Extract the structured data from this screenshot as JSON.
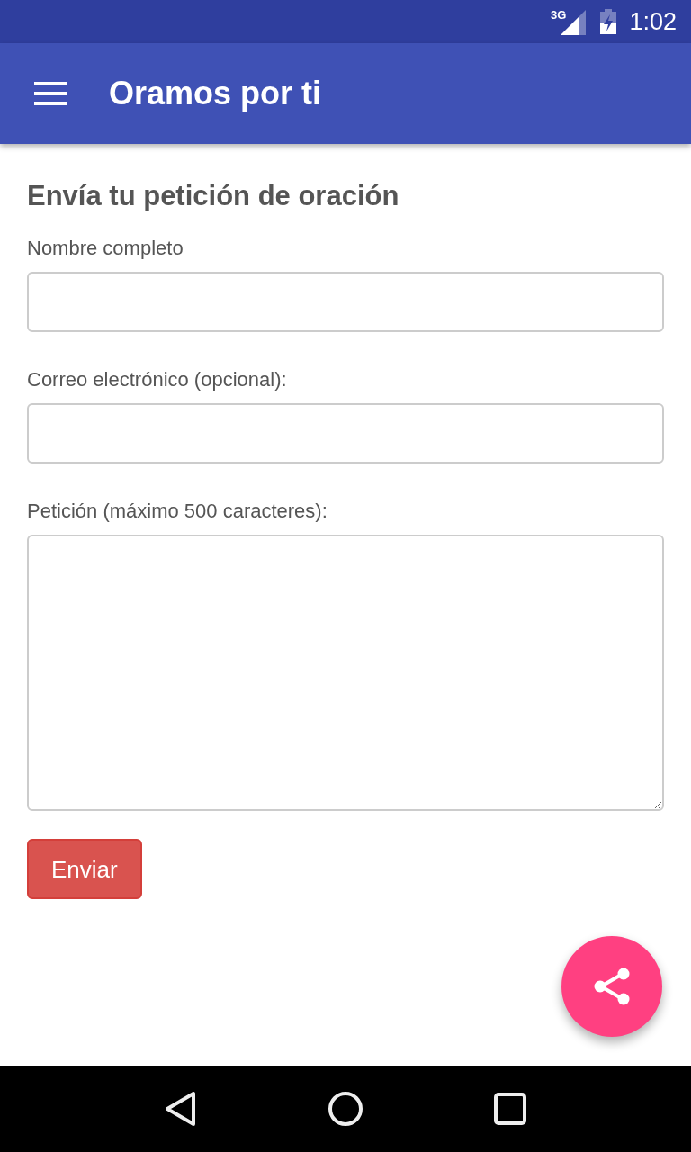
{
  "status_bar": {
    "network_type": "3G",
    "time": "1:02"
  },
  "app_bar": {
    "title": "Oramos por ti"
  },
  "form": {
    "heading": "Envía tu petición de oración",
    "fields": [
      {
        "kind": "input",
        "label": "Nombre completo"
      },
      {
        "kind": "input",
        "label": "Correo electrónico (opcional):"
      },
      {
        "kind": "textarea",
        "label": "Petición (máximo 500 caracteres):"
      }
    ],
    "submit": "Enviar"
  }
}
